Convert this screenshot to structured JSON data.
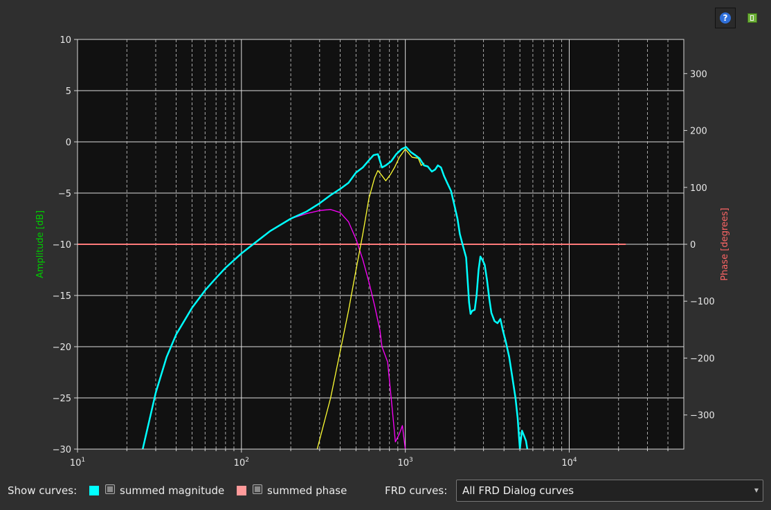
{
  "toolbar": {
    "help_icon": "help-icon",
    "help_glyph": "?",
    "exit_icon": "exit-icon"
  },
  "controls": {
    "show_curves_label": "Show curves:",
    "summed_magnitude_label": "summed magnitude",
    "summed_magnitude_color": "#00ffff",
    "summed_magnitude_checked": false,
    "summed_phase_label": "summed phase",
    "summed_phase_color": "#ff9a9a",
    "summed_phase_checked": false,
    "frd_curves_label": "FRD curves:",
    "frd_curves_value": "All FRD Dialog curves"
  },
  "chart_data": {
    "type": "line",
    "background": "#111111",
    "xscale": "log",
    "xlim": [
      10,
      50000
    ],
    "ylim": [
      -30,
      10
    ],
    "y2lim": [
      -360,
      360
    ],
    "grid": true,
    "ylabel": "Amplitude [dB]",
    "ylabel_color": "#00cc00",
    "y2label": "Phase [degrees]",
    "y2label_color": "#ff6666",
    "x_ticks": [
      10,
      100,
      1000,
      10000
    ],
    "x_tick_labels": [
      {
        "base": "10",
        "exp": "1"
      },
      {
        "base": "10",
        "exp": "2"
      },
      {
        "base": "10",
        "exp": "3"
      },
      {
        "base": "10",
        "exp": "4"
      }
    ],
    "y_ticks": [
      10,
      5,
      0,
      -5,
      -10,
      -15,
      -20,
      -25,
      -30
    ],
    "y_tick_labels": [
      "10",
      "5",
      "0",
      "−5",
      "−10",
      "−15",
      "−20",
      "−25",
      "−30"
    ],
    "y2_ticks": [
      300,
      200,
      100,
      0,
      -100,
      -200,
      -300
    ],
    "y2_tick_labels": [
      "300",
      "200",
      "100",
      "0",
      "−100",
      "−200",
      "−300"
    ],
    "series": [
      {
        "color": "#ff7a7a",
        "axis": "right",
        "width": 2,
        "points": [
          [
            10,
            0
          ],
          [
            22000,
            0
          ]
        ]
      },
      {
        "color": "#ff00ff",
        "axis": "left",
        "width": 1.3,
        "points": [
          [
            200,
            -7.5
          ],
          [
            250,
            -7
          ],
          [
            300,
            -6.7
          ],
          [
            350,
            -6.6
          ],
          [
            400,
            -6.9
          ],
          [
            450,
            -7.8
          ],
          [
            500,
            -9.5
          ],
          [
            550,
            -11.5
          ],
          [
            600,
            -13.7
          ],
          [
            650,
            -16
          ],
          [
            700,
            -18.4
          ],
          [
            720,
            -20
          ],
          [
            780,
            -21.5
          ],
          [
            820,
            -25
          ],
          [
            870,
            -29.3
          ],
          [
            920,
            -28.5
          ],
          [
            960,
            -27.7
          ],
          [
            1000,
            -30
          ]
        ]
      },
      {
        "color": "#ffff33",
        "axis": "left",
        "width": 1.3,
        "points": [
          [
            290,
            -30
          ],
          [
            350,
            -25
          ],
          [
            400,
            -20.5
          ],
          [
            450,
            -16.5
          ],
          [
            500,
            -12.5
          ],
          [
            550,
            -9
          ],
          [
            600,
            -5.5
          ],
          [
            650,
            -3.5
          ],
          [
            680,
            -2.8
          ],
          [
            720,
            -3.3
          ],
          [
            760,
            -3.8
          ],
          [
            810,
            -3.2
          ],
          [
            860,
            -2.5
          ],
          [
            920,
            -1.5
          ],
          [
            1000,
            -0.7
          ],
          [
            1100,
            -1.5
          ],
          [
            1200,
            -1.6
          ],
          [
            1250,
            -2.3
          ],
          [
            1300,
            -2.1
          ]
        ]
      },
      {
        "color": "#00ffff",
        "axis": "left",
        "width": 2.5,
        "points": [
          [
            25,
            -30
          ],
          [
            30,
            -24.5
          ],
          [
            35,
            -21
          ],
          [
            40,
            -18.8
          ],
          [
            50,
            -16.2
          ],
          [
            60,
            -14.5
          ],
          [
            70,
            -13.3
          ],
          [
            80,
            -12.3
          ],
          [
            100,
            -10.9
          ],
          [
            120,
            -9.9
          ],
          [
            150,
            -8.7
          ],
          [
            200,
            -7.5
          ],
          [
            250,
            -6.8
          ],
          [
            300,
            -6
          ],
          [
            350,
            -5.2
          ],
          [
            400,
            -4.6
          ],
          [
            450,
            -4
          ],
          [
            500,
            -3
          ],
          [
            550,
            -2.5
          ],
          [
            600,
            -1.8
          ],
          [
            640,
            -1.3
          ],
          [
            680,
            -1.2
          ],
          [
            720,
            -2.5
          ],
          [
            760,
            -2.3
          ],
          [
            820,
            -1.9
          ],
          [
            880,
            -1.2
          ],
          [
            950,
            -0.7
          ],
          [
            1010,
            -0.5
          ],
          [
            1080,
            -1
          ],
          [
            1150,
            -1.3
          ],
          [
            1220,
            -1.6
          ],
          [
            1300,
            -2.3
          ],
          [
            1370,
            -2.4
          ],
          [
            1450,
            -2.9
          ],
          [
            1520,
            -2.7
          ],
          [
            1580,
            -2.3
          ],
          [
            1650,
            -2.5
          ],
          [
            1720,
            -3.3
          ],
          [
            1800,
            -4
          ],
          [
            1900,
            -4.8
          ],
          [
            2000,
            -6.3
          ],
          [
            2080,
            -7.5
          ],
          [
            2150,
            -9
          ],
          [
            2250,
            -10.2
          ],
          [
            2350,
            -11.3
          ],
          [
            2450,
            -15.7
          ],
          [
            2500,
            -16.8
          ],
          [
            2560,
            -16.5
          ],
          [
            2650,
            -16.4
          ],
          [
            2720,
            -15
          ],
          [
            2800,
            -12.5
          ],
          [
            2870,
            -11.2
          ],
          [
            2950,
            -11.5
          ],
          [
            3050,
            -12
          ],
          [
            3150,
            -13.5
          ],
          [
            3250,
            -15.3
          ],
          [
            3350,
            -16.7
          ],
          [
            3500,
            -17.5
          ],
          [
            3650,
            -17.7
          ],
          [
            3800,
            -17.3
          ],
          [
            3950,
            -18.5
          ],
          [
            4100,
            -19.5
          ],
          [
            4300,
            -21
          ],
          [
            4500,
            -23
          ],
          [
            4700,
            -25
          ],
          [
            4850,
            -27
          ],
          [
            4950,
            -29
          ],
          [
            5000,
            -30
          ],
          [
            5050,
            -29.3
          ],
          [
            5150,
            -28.2
          ],
          [
            5300,
            -28.7
          ],
          [
            5450,
            -29.2
          ],
          [
            5550,
            -30
          ]
        ]
      }
    ]
  }
}
